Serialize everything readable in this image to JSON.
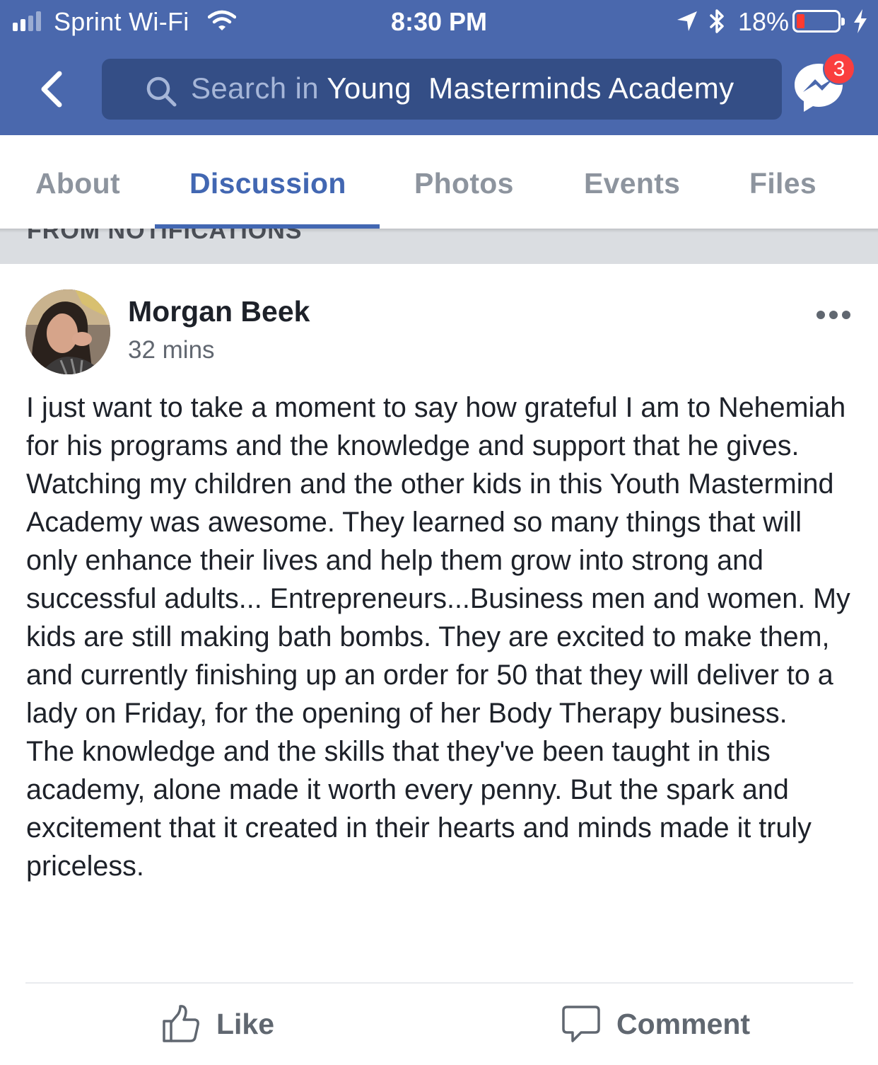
{
  "status_bar": {
    "carrier": "Sprint Wi-Fi",
    "time": "8:30 PM",
    "battery_percent": "18%",
    "battery_level": 0.18,
    "icons": [
      "signal-icon",
      "wifi-icon",
      "location-arrow-icon",
      "bluetooth-icon",
      "battery-icon",
      "charging-bolt-icon"
    ]
  },
  "header": {
    "search_prefix": "Search in",
    "search_group": "Young  Masterminds Academy",
    "messenger_badge": "3",
    "colors": {
      "bar": "#4a68ad",
      "search_field": "#344e86",
      "badge": "#fa3e3e"
    }
  },
  "tabs": [
    {
      "label": "About",
      "active": false
    },
    {
      "label": "Discussion",
      "active": true
    },
    {
      "label": "Photos",
      "active": false
    },
    {
      "label": "Events",
      "active": false
    },
    {
      "label": "Files",
      "active": false
    }
  ],
  "section_header": "FROM NOTIFICATIONS",
  "post": {
    "author": "Morgan Beek",
    "time": "32 mins",
    "paragraphs": [
      "I just want to take a moment to say how grateful I am to Nehemiah for his programs and the knowledge and support that he gives. Watching my children and the other kids in this Youth Mastermind Academy was awesome. They learned so many things that will only enhance their lives and help them grow into strong and successful adults... Entrepreneurs...Business men and women. My kids are still making bath bombs. They are excited to make them, and currently finishing up an order for 50 that they will deliver to a lady on Friday, for the opening of her Body Therapy business.",
      "The knowledge and the skills that they've been taught in this academy, alone made it worth every penny. But the spark and excitement that it created in their hearts and minds made it truly priceless."
    ],
    "actions": {
      "like": "Like",
      "comment": "Comment"
    }
  }
}
